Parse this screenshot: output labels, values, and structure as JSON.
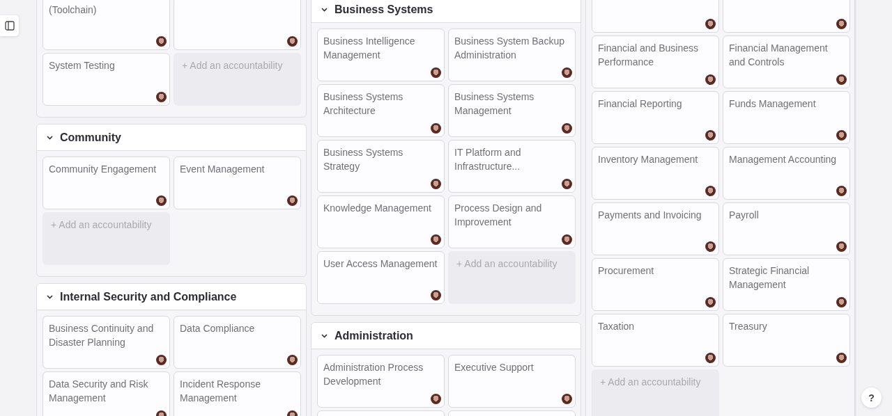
{
  "columns": [
    {
      "groups": [
        {
          "cards": [
            {
              "kind": "titled",
              "title": "(Toolchain)"
            },
            {
              "kind": "cut"
            },
            {
              "kind": "titled",
              "title": "System Testing"
            }
          ],
          "add_label": "+ Add an accountability"
        },
        {
          "title": "Community",
          "expanded": true,
          "cards": [
            {
              "kind": "titled",
              "title": "Community Engagement"
            },
            {
              "kind": "titled",
              "title": "Event Management"
            }
          ],
          "add_label": "+ Add an accountability"
        },
        {
          "title": "Internal Security and Compliance",
          "expanded": true,
          "cards": [
            {
              "kind": "titled",
              "title": "Business Continuity and Disaster Planning"
            },
            {
              "kind": "titled",
              "title": "Data Compliance"
            },
            {
              "kind": "titled",
              "title": "Data Security and Risk Management"
            },
            {
              "kind": "titled",
              "title": "Incident Response Management"
            }
          ]
        }
      ]
    },
    {
      "groups": [
        {
          "title": "Business Systems",
          "expanded": true,
          "cards": [
            {
              "kind": "titled",
              "title": "Business Intelligence Management"
            },
            {
              "kind": "titled",
              "title": "Business System Backup Administration"
            },
            {
              "kind": "titled",
              "title": "Business Systems Architecture"
            },
            {
              "kind": "titled",
              "title": "Business Systems Management"
            },
            {
              "kind": "titled",
              "title": "Business Systems Strategy"
            },
            {
              "kind": "titled",
              "title": "IT Platform and Infrastructure..."
            },
            {
              "kind": "titled",
              "title": "Knowledge Management"
            },
            {
              "kind": "titled",
              "title": "Process Design and Improvement"
            },
            {
              "kind": "titled",
              "title": "User Access Management"
            }
          ],
          "add_label": "+ Add an accountability"
        },
        {
          "title": "Administration",
          "expanded": true,
          "cards": [
            {
              "kind": "titled",
              "title": "Administration Process Development"
            },
            {
              "kind": "titled",
              "title": "Executive Support"
            },
            {
              "kind": "cut"
            },
            {
              "kind": "cut"
            }
          ]
        }
      ]
    },
    {
      "groups": [
        {
          "cards": [
            {
              "kind": "cut"
            },
            {
              "kind": "cut"
            },
            {
              "kind": "titled",
              "title": "Financial and Business Performance"
            },
            {
              "kind": "titled",
              "title": "Financial Management and Controls"
            },
            {
              "kind": "titled",
              "title": "Financial Reporting"
            },
            {
              "kind": "titled",
              "title": "Funds Management"
            },
            {
              "kind": "titled",
              "title": "Inventory Management"
            },
            {
              "kind": "titled",
              "title": "Management Accounting"
            },
            {
              "kind": "titled",
              "title": "Payments and Invoicing"
            },
            {
              "kind": "titled",
              "title": "Payroll"
            },
            {
              "kind": "titled",
              "title": "Procurement"
            },
            {
              "kind": "titled",
              "title": "Strategic Financial Management"
            },
            {
              "kind": "titled",
              "title": "Taxation"
            },
            {
              "kind": "titled",
              "title": "Treasury"
            }
          ],
          "add_label": "+ Add an accountability"
        }
      ]
    }
  ],
  "help_button": {
    "label": "?"
  }
}
